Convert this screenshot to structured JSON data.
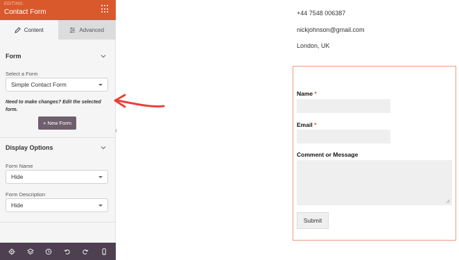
{
  "sidebar": {
    "editing_label": "EDITING:",
    "title": "Contact Form",
    "tabs": [
      {
        "label": "Content",
        "icon": "pencil-icon",
        "active": true
      },
      {
        "label": "Advanced",
        "icon": "sliders-icon",
        "active": false
      }
    ],
    "form_section": {
      "title": "Form",
      "select_label": "Select a Form",
      "select_value": "Simple Contact Form",
      "help_text": "Need to make changes? Edit the selected form.",
      "new_form_button": "+ New Form"
    },
    "display_section": {
      "title": "Display Options",
      "form_name_label": "Form Name",
      "form_name_value": "Hide",
      "form_description_label": "Form Description",
      "form_description_value": "Hide"
    },
    "bottom_icons": [
      "settings-icon",
      "layers-icon",
      "history-icon",
      "undo-icon",
      "redo-icon",
      "mobile-preview-icon"
    ]
  },
  "content": {
    "phone": "+44 7548 006387",
    "email": "nickjohnson@gmail.com",
    "location": "London, UK",
    "form": {
      "name_label": "Name",
      "email_label": "Email",
      "required_mark": "*",
      "comment_label": "Comment or Message",
      "submit_label": "Submit"
    }
  },
  "colors": {
    "header": "#d9582c",
    "bottom_bar": "#4e3f51",
    "button": "#6f5f6c",
    "arrow": "#e8413a",
    "form_border": "#ef9b7e"
  }
}
